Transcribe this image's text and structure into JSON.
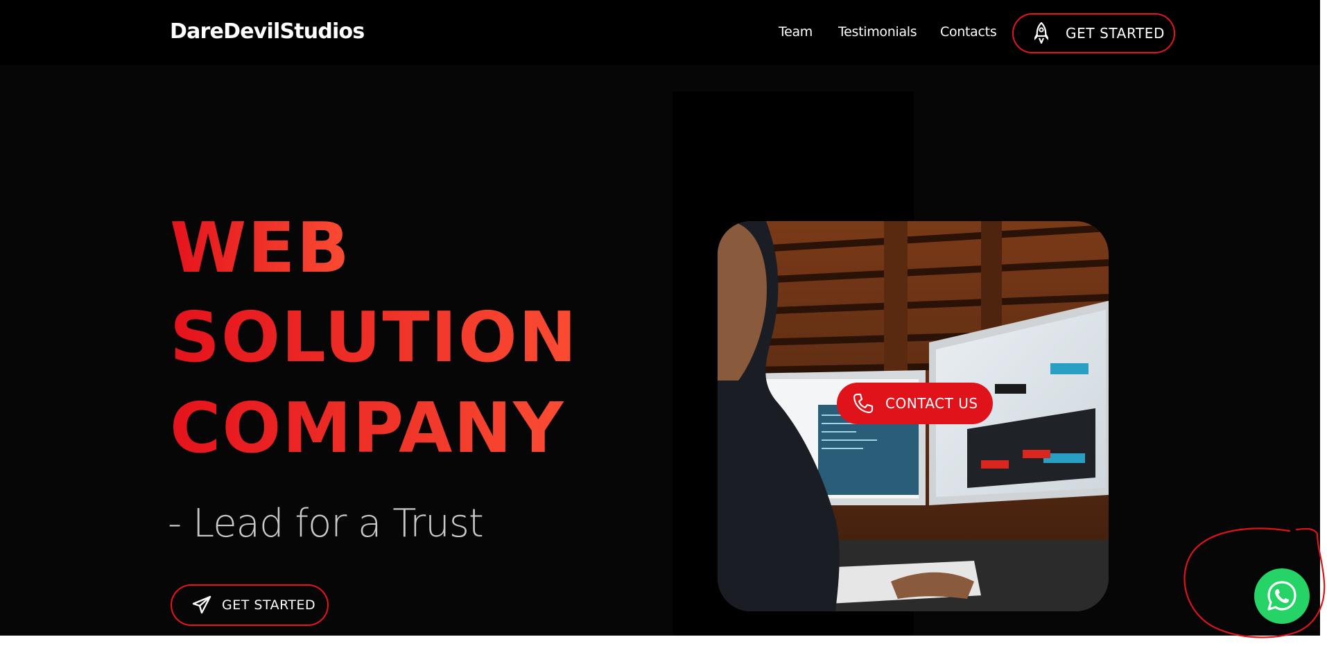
{
  "header": {
    "logo": "DareDevilStudios",
    "nav": [
      {
        "label": "Team"
      },
      {
        "label": "Testimonials"
      },
      {
        "label": "Contacts"
      }
    ],
    "cta_label": "GET STARTED",
    "cta_icon": "rocket-icon"
  },
  "hero": {
    "headline_lines": [
      "WEB",
      "SOLUTION",
      "COMPANY"
    ],
    "tagline": "- Lead for a Trust",
    "cta_label": "GET STARTED",
    "cta_icon": "paper-plane-icon",
    "photo_icon": "developer-at-computer-photo",
    "contact_label": "CONTACT US",
    "contact_icon": "phone-icon"
  },
  "floating": {
    "whatsapp_icon": "whatsapp-icon"
  },
  "colors": {
    "accent": "#e8141c",
    "whatsapp": "#25d366",
    "background": "#060606",
    "header": "#000000"
  }
}
